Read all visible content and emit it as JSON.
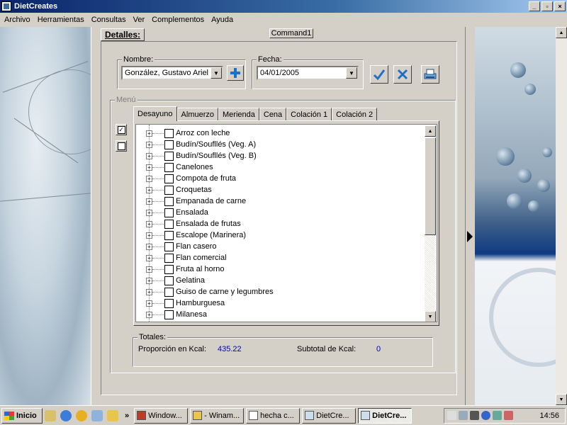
{
  "window": {
    "title": "DietCreates"
  },
  "menubar": [
    "Archivo",
    "Herramientas",
    "Consultas",
    "Ver",
    "Complementos",
    "Ayuda"
  ],
  "form": {
    "details_tab": "Detalles:",
    "command_button": "Command1",
    "nombre_label": "Nombre:",
    "nombre_value": "González, Gustavo Ariel",
    "fecha_label": "Fecha:",
    "fecha_value": "04/01/2005",
    "menu_label": "Menú",
    "tabs": [
      "Desayuno",
      "Almuerzo",
      "Merienda",
      "Cena",
      "Colación 1",
      "Colación 2"
    ],
    "active_tab": "Desayuno",
    "items": [
      "Arroz con leche",
      "Budín/Soufllés (Veg. A)",
      "Budín/Soufllés (Veg. B)",
      "Canelones",
      "Compota de fruta",
      "Croquetas",
      "Empanada de carne",
      "Ensalada",
      "Ensalada de frutas",
      "Escalope (Marinera)",
      "Flan casero",
      "Flan comercial",
      "Fruta al horno",
      "Gelatina",
      "Guiso de carne y legumbres",
      "Hamburguesa",
      "Milanesa"
    ],
    "totals": {
      "label": "Totales:",
      "proporcion_label": "Proporción en Kcal:",
      "proporcion_value": "435.22",
      "subtotal_label": "Subtotal de Kcal:",
      "subtotal_value": "0"
    }
  },
  "taskbar": {
    "start_label": "Inicio",
    "quicklaunch_more": "»",
    "tasks": [
      "Window...",
      "- Winam...",
      "hecha c...",
      "DietCre...",
      "DietCre..."
    ],
    "active_task_index": 4,
    "clock": "14:56"
  },
  "colors": {
    "titlebar": "#0a246a",
    "accent_blue": "#0000c0",
    "face": "#d4d0c8"
  }
}
